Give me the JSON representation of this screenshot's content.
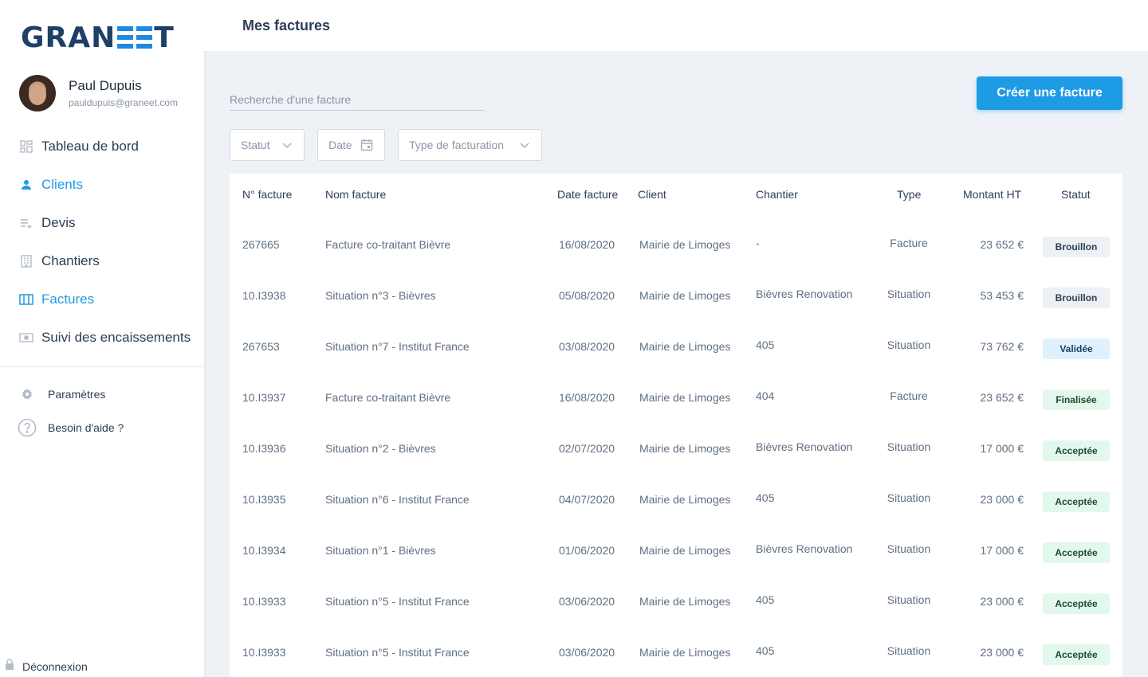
{
  "app": {
    "logo_left": "GRAN",
    "logo_right": "T"
  },
  "user": {
    "name": "Paul Dupuis",
    "email": "pauldupuis@graneet.com"
  },
  "sidebar": {
    "items": [
      {
        "label": "Tableau de bord",
        "icon": "dashboard-icon"
      },
      {
        "label": "Clients",
        "icon": "user-icon",
        "active": true
      },
      {
        "label": "Devis",
        "icon": "quote-list-icon"
      },
      {
        "label": "Chantiers",
        "icon": "building-icon"
      },
      {
        "label": "Factures",
        "icon": "invoice-icon",
        "active": true
      },
      {
        "label": "Suivi des encaissements",
        "icon": "cash-icon"
      }
    ],
    "settings_label": "Paramètres",
    "help_label": "Besoin d'aide ?",
    "logout_label": "Déconnexion"
  },
  "header": {
    "title": "Mes factures"
  },
  "toolbar": {
    "search_placeholder": "Recherche d'une facture",
    "create_label": "Créer une facture",
    "filters": {
      "status": "Statut",
      "date": "Date",
      "billing_type": "Type de facturation"
    }
  },
  "table": {
    "headers": {
      "number": "N° facture",
      "name": "Nom facture",
      "date": "Date facture",
      "client": "Client",
      "site": "Chantier",
      "type": "Type",
      "amount": "Montant HT",
      "status": "Statut"
    },
    "rows": [
      {
        "number": "267665",
        "name": "Facture co-traitant Bièvre",
        "date": "16/08/2020",
        "client": "Mairie de Limoges",
        "site": "-",
        "type": "Facture",
        "amount": "23 652 €",
        "status": "Brouillon",
        "status_kind": "draft"
      },
      {
        "number": "10.I3938",
        "name": "Situation n°3 - Bièvres",
        "date": "05/08/2020",
        "client": "Mairie de Limoges",
        "site": "Bièvres Renovation",
        "type": "Situation",
        "amount": "53 453 €",
        "status": "Brouillon",
        "status_kind": "draft"
      },
      {
        "number": "267653",
        "name": "Situation n°7 - Institut France",
        "date": "03/08/2020",
        "client": "Mairie de Limoges",
        "site": "405",
        "type": "Situation",
        "amount": "73 762 €",
        "status": "Validée",
        "status_kind": "validated"
      },
      {
        "number": "10.I3937",
        "name": "Facture co-traitant Bièvre",
        "date": "16/08/2020",
        "client": "Mairie de Limoges",
        "site": "404",
        "type": "Facture",
        "amount": "23 652 €",
        "status": "Finalisée",
        "status_kind": "accepted"
      },
      {
        "number": "10.I3936",
        "name": "Situation n°2 - Bièvres",
        "date": "02/07/2020",
        "client": "Mairie de Limoges",
        "site": "Bièvres Renovation",
        "type": "Situation",
        "amount": "17 000 €",
        "status": "Acceptée",
        "status_kind": "accepted"
      },
      {
        "number": "10.I3935",
        "name": "Situation n°6 - Institut France",
        "date": "04/07/2020",
        "client": "Mairie de Limoges",
        "site": "405",
        "type": "Situation",
        "amount": "23 000 €",
        "status": "Acceptée",
        "status_kind": "accepted"
      },
      {
        "number": "10.I3934",
        "name": "Situation n°1 - Bièvres",
        "date": "01/06/2020",
        "client": "Mairie de Limoges",
        "site": "Bièvres Renovation",
        "type": "Situation",
        "amount": "17 000 €",
        "status": "Acceptée",
        "status_kind": "accepted"
      },
      {
        "number": "10.I3933",
        "name": "Situation n°5 - Institut France",
        "date": "03/06/2020",
        "client": "Mairie de Limoges",
        "site": "405",
        "type": "Situation",
        "amount": "23 000 €",
        "status": "Acceptée",
        "status_kind": "accepted"
      },
      {
        "number": "10.I3933",
        "name": "Situation n°5 - Institut France",
        "date": "03/06/2020",
        "client": "Mairie de Limoges",
        "site": "405",
        "type": "Situation",
        "amount": "23 000 €",
        "status": "Acceptée",
        "status_kind": "accepted"
      }
    ]
  },
  "colors": {
    "accent": "#1e9be5",
    "logo": "#1e3f66",
    "draft_bg": "#edf0f4",
    "draft_fg": "#2c3e55",
    "validated_bg": "#dff1fc",
    "validated_fg": "#1b3f66",
    "accepted_bg": "#e3f8ec",
    "accepted_fg": "#1c4a32"
  }
}
